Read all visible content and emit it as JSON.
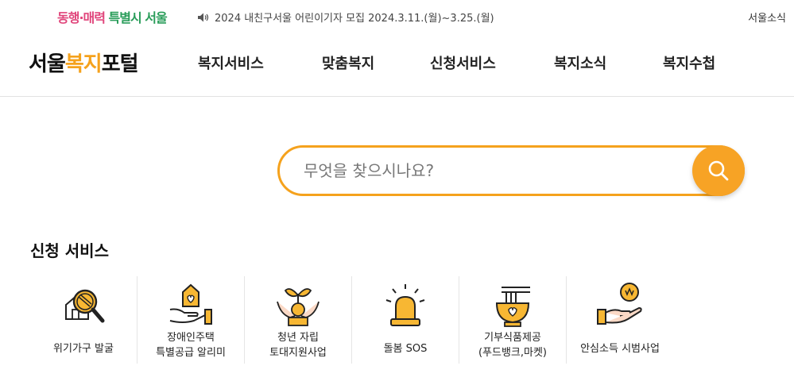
{
  "topbar": {
    "slogan_part1": "동행·매력",
    "slogan_part2": "특별시 서울",
    "notice": "2024 내친구서울 어린이기자 모집 2024.3.11.(월)~3.25.(월)",
    "seoul_news": "서울소식"
  },
  "header": {
    "logo_part1": "서울",
    "logo_part2": "복지",
    "logo_part3": "포털",
    "nav": [
      "복지서비스",
      "맞춤복지",
      "신청서비스",
      "복지소식",
      "복지수첩"
    ]
  },
  "search": {
    "placeholder": "무엇을 찾으시나요?",
    "value": ""
  },
  "services": {
    "title": "신청 서비스",
    "items": [
      {
        "label": "위기가구 발굴",
        "icon": "magnifier-house-icon"
      },
      {
        "label": "장애인주택\n특별공급 알리미",
        "icon": "hand-house-icon"
      },
      {
        "label": "청년 자립\n토대지원사업",
        "icon": "hands-sprout-icon"
      },
      {
        "label": "돌봄 SOS",
        "icon": "alarm-light-icon"
      },
      {
        "label": "기부식품제공\n(푸드뱅크,마켓)",
        "icon": "food-bowl-icon"
      },
      {
        "label": "안심소득 시범사업",
        "icon": "hand-coin-icon"
      }
    ]
  },
  "colors": {
    "accent": "#f5a21d",
    "slogan_pink": "#e0457b",
    "slogan_green": "#2a9d5a"
  }
}
